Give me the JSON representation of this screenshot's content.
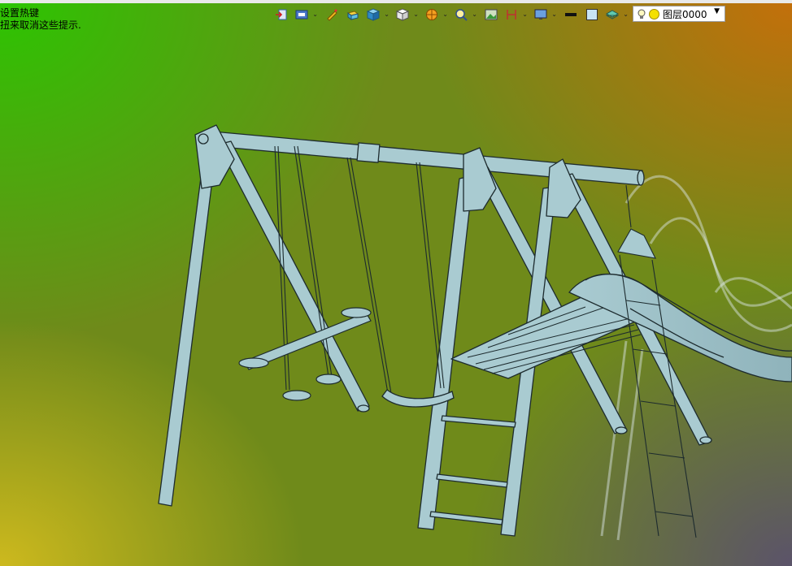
{
  "hint": {
    "line1": "设置热键",
    "line2": "扭来取消这些提示."
  },
  "toolbar": {
    "icons": [
      "import-icon",
      "display-mode-icon",
      "pencil-icon",
      "view-box-icon",
      "cube-icon",
      "white-cube-icon",
      "render-sphere-icon",
      "zoom-icon",
      "image-icon",
      "dimension-icon",
      "monitor-icon",
      "line-color-icon",
      "fill-color-icon",
      "layer-stack-icon"
    ]
  },
  "layer": {
    "name": "图层0000"
  },
  "colors": {
    "model_fill": "#a9cbd1",
    "model_stroke": "#1d2b2e"
  }
}
